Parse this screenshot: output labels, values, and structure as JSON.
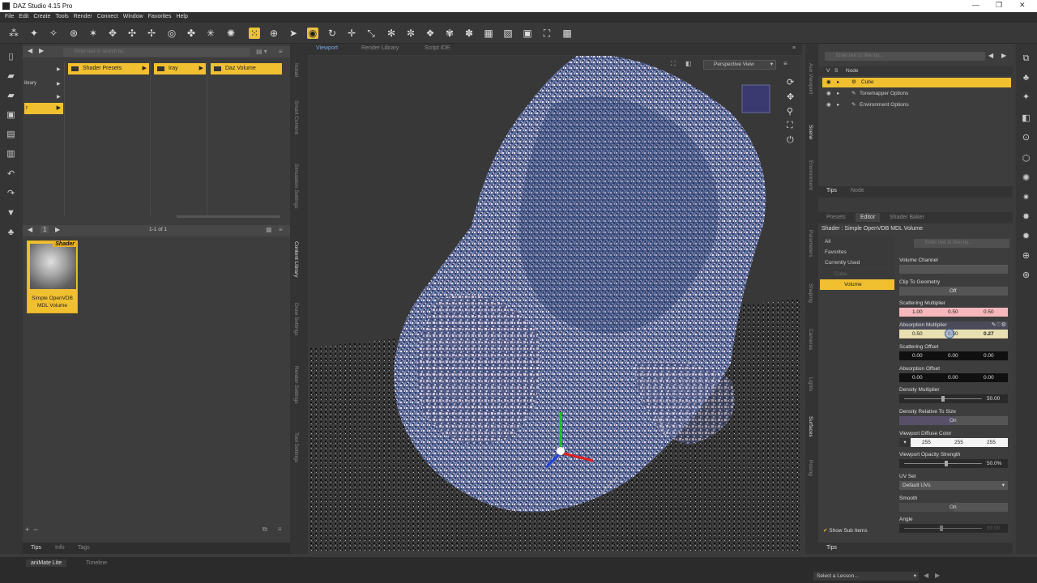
{
  "window": {
    "title": "DAZ Studio 4.15 Pro"
  },
  "menu": [
    "File",
    "Edit",
    "Create",
    "Tools",
    "Render",
    "Connect",
    "Window",
    "Favorites",
    "Help"
  ],
  "content_library": {
    "search_placeholder": "Enter text to search by...",
    "col1_items": [
      "ibrary"
    ],
    "col1_selected_text": "r",
    "col2_selected": "Shader Presets",
    "col3_selected": "Iray",
    "col4_selected": "Daz Volume",
    "pagination": "1",
    "range": "1-1 of 1",
    "asset_badge": "Shader",
    "asset_label": "Simple OpenVDB MDL Volume",
    "bottom_tabs": [
      "Tips",
      "Info",
      "Tags"
    ]
  },
  "left_vtabs": [
    "Install",
    "Smart Content",
    "Simulation Settings",
    "Content Library",
    "Draw Settings",
    "Render Settings",
    "Tool Settings"
  ],
  "viewport": {
    "tabs": [
      "Viewport",
      "Render Library",
      "Script IDE"
    ],
    "camera": "Perspective View"
  },
  "right_vtabs": [
    "Aux Viewport",
    "Scene",
    "Environment",
    "Parameters",
    "Shaping",
    "Cameras",
    "Lights",
    "Surfaces",
    "Posing"
  ],
  "scene": {
    "search_placeholder": "Enter text to filter by...",
    "header_col": "Node",
    "nodes": [
      "Cube",
      "Tonemapper Options",
      "Environment Options"
    ],
    "tabs": [
      "Tips",
      "Node"
    ]
  },
  "surfaces": {
    "tabs": [
      "Presets",
      "Editor",
      "Shader Baker"
    ],
    "shader_title": "Shader : Simple OpenVDB MDL Volume",
    "filter_placeholder": "Enter text to filter by...",
    "groups": [
      "All",
      "Favorites",
      "Currently Used",
      "Cube",
      "Volume"
    ],
    "show_sub_items": "Show Sub Items",
    "tips_tab": "Tips",
    "params": {
      "volume_channel": "Volume Channel",
      "clip_to_geometry": {
        "label": "Clip To Geometry",
        "value": "Off"
      },
      "scattering_multiplier": {
        "label": "Scattering Multiplier",
        "v": [
          "1.00",
          "0.50",
          "0.50"
        ]
      },
      "absorption_multiplier": {
        "label": "Absorption Multiplier",
        "v": [
          "0.50",
          "0.50",
          "0.27"
        ]
      },
      "scattering_offset": {
        "label": "Scattering Offset",
        "v": [
          "0.00",
          "0.00",
          "0.00"
        ]
      },
      "absorption_offset": {
        "label": "Absorption Offset",
        "v": [
          "0.00",
          "0.00",
          "0.00"
        ]
      },
      "density_multiplier": {
        "label": "Density Multiplier",
        "value": "50.00"
      },
      "density_relative": {
        "label": "Density Relative To Size",
        "value": "On"
      },
      "viewport_diffuse": {
        "label": "Viewport Diffuse Color",
        "v": [
          "255",
          "255",
          "255"
        ]
      },
      "viewport_opacity": {
        "label": "Viewport Opacity Strength",
        "value": "50.0%"
      },
      "uv_set": {
        "label": "UV Set",
        "value": "Default UVs"
      },
      "smooth": {
        "label": "Smooth",
        "value": "On"
      },
      "angle": {
        "label": "Angle",
        "value": "89.90"
      }
    }
  },
  "bottom": {
    "tabs": [
      "aniMate Lite",
      "Timeline"
    ],
    "lesson": "Select a Lesson..."
  },
  "colors": {
    "accent": "#f0c030",
    "bg": "#3d3d3d"
  }
}
